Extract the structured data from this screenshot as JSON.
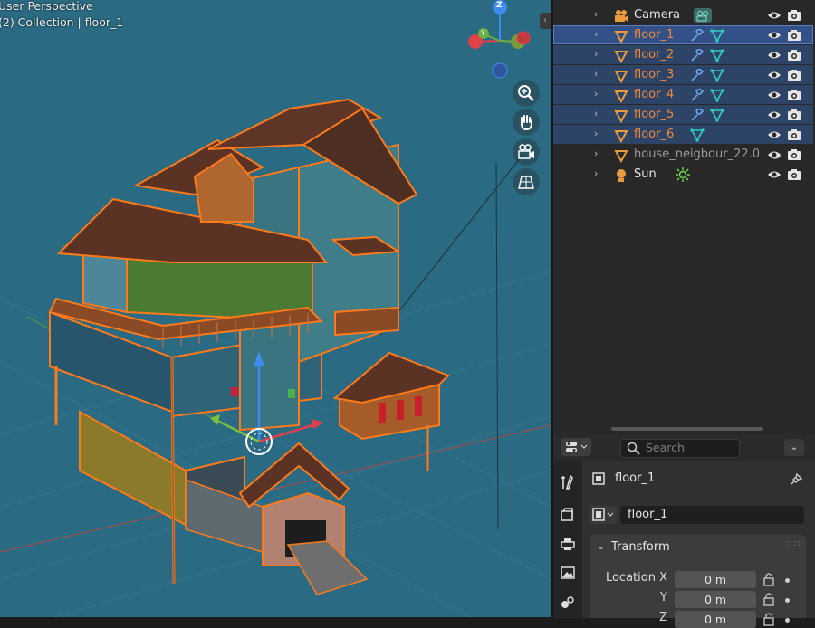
{
  "viewport": {
    "view_name": "User Perspective",
    "context": "(2) Collection | floor_1",
    "gizmo": {
      "z_label": "Z",
      "y_label": "Y"
    },
    "nav_buttons": [
      "zoom-icon",
      "hand-pan-icon",
      "camera-view-icon",
      "grid-view-icon"
    ]
  },
  "outliner": {
    "rows": [
      {
        "label": "Camera",
        "icon": "camera-object-icon",
        "data_icon": "camera-data-icon",
        "state": "normal"
      },
      {
        "label": "floor_1",
        "icon": "mesh-object-icon",
        "data_icon": "modifier-and-mesh-icons",
        "state": "active"
      },
      {
        "label": "floor_2",
        "icon": "mesh-object-icon",
        "data_icon": "modifier-and-mesh-icons",
        "state": "selected"
      },
      {
        "label": "floor_3",
        "icon": "mesh-object-icon",
        "data_icon": "modifier-and-mesh-icons",
        "state": "selected"
      },
      {
        "label": "floor_4",
        "icon": "mesh-object-icon",
        "data_icon": "modifier-and-mesh-icons",
        "state": "selected"
      },
      {
        "label": "floor_5",
        "icon": "mesh-object-icon",
        "data_icon": "modifier-and-mesh-icons",
        "state": "selected"
      },
      {
        "label": "floor_6",
        "icon": "mesh-object-icon",
        "data_icon": "mesh-data-icon",
        "state": "selected"
      },
      {
        "label": "house_neigbour_22.0",
        "icon": "mesh-object-icon",
        "data_icon": "curve-icon",
        "state": "dim"
      },
      {
        "label": "Sun",
        "icon": "light-object-icon",
        "data_icon": "sun-data-icon",
        "state": "normal"
      }
    ]
  },
  "properties": {
    "search_placeholder": "Search",
    "object_name": "floor_1",
    "name_field": "floor_1",
    "panel_title": "Transform",
    "location": {
      "label_x": "Location X",
      "label_y": "Y",
      "label_z": "Z",
      "x": "0 m",
      "y": "0 m",
      "z": "0 m"
    },
    "tabs": [
      "tool-icon",
      "render-icon",
      "output-icon",
      "image-icon",
      "physics-icon"
    ]
  },
  "colors": {
    "viewport_bg": "#2a6a82",
    "selection_outline": "#ff7a1a",
    "active_row": "#345187",
    "selected_row": "#2d4467",
    "object_name": "#ee8a3a"
  }
}
